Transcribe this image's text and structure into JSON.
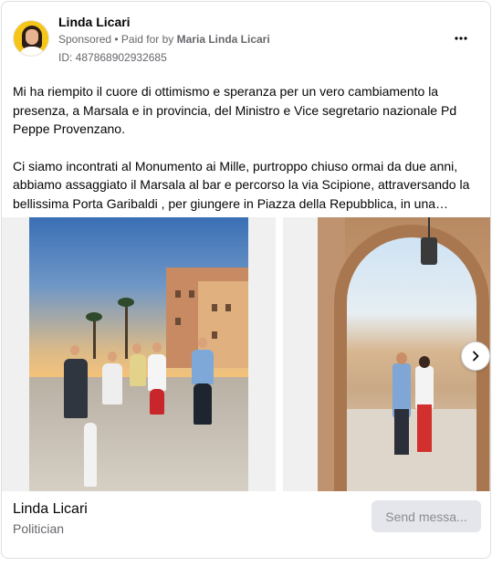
{
  "header": {
    "page_name": "Linda Licari",
    "sponsored_label": "Sponsored",
    "separator": " • ",
    "paid_for_label": "Paid for by",
    "payer": "Maria Linda Licari",
    "ad_id": "ID: 487868902932685",
    "more_icon": "ellipsis-icon"
  },
  "post": {
    "paragraphs": [
      "Mi ha riempito il cuore di ottimismo e speranza per un vero cambiamento la presenza, a Marsala e in provincia, del Ministro e Vice segretario nazionale Pd Peppe Provenzano.",
      "Ci siamo incontrati al Monumento ai Mille, purtroppo chiuso ormai da due anni, abbiamo assaggiato il Marsala al bar e percorso la via Scipione, attraversando la bellissima Porta Garibaldi , per giungere in Piazza della Repubblica, in una…"
    ]
  },
  "carousel": {
    "next_icon": "chevron-right-icon"
  },
  "footer": {
    "name": "Linda Licari",
    "role": "Politician",
    "send_button": "Send messa..."
  }
}
